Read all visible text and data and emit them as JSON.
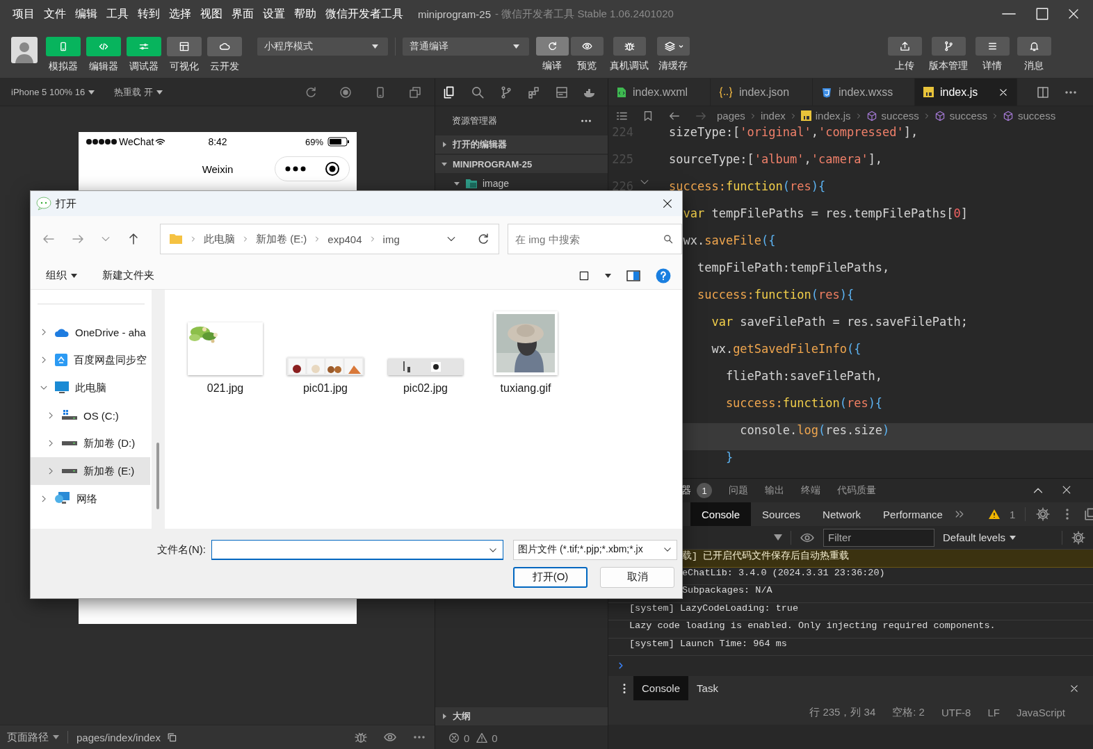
{
  "menu_bar": {
    "items": [
      "项目",
      "文件",
      "编辑",
      "工具",
      "转到",
      "选择",
      "视图",
      "界面",
      "设置",
      "帮助",
      "微信开发者工具"
    ],
    "title": "miniprogram-25",
    "subtitle": "- 微信开发者工具 Stable 1.06.2401020"
  },
  "toolbar": {
    "view_buttons": [
      {
        "label": "模拟器",
        "kind": "simulator",
        "on": true
      },
      {
        "label": "编辑器",
        "kind": "editor",
        "on": true
      },
      {
        "label": "调试器",
        "kind": "debugger",
        "on": true
      },
      {
        "label": "可视化",
        "kind": "visual",
        "on": false
      },
      {
        "label": "云开发",
        "kind": "cloud",
        "on": false
      }
    ],
    "mode": "小程序模式",
    "compile_mode": "普通编译",
    "actions": [
      {
        "label": "编译",
        "kind": "compile",
        "highlighted": true
      },
      {
        "label": "预览",
        "kind": "preview",
        "highlighted": false
      },
      {
        "label": "真机调试",
        "kind": "remote-debug",
        "highlighted": false
      },
      {
        "label": "清缓存",
        "kind": "clear-cache",
        "highlighted": false
      }
    ],
    "right_buttons": [
      {
        "label": "上传",
        "kind": "upload"
      },
      {
        "label": "版本管理",
        "kind": "version"
      },
      {
        "label": "详情",
        "kind": "details"
      },
      {
        "label": "消息",
        "kind": "messages"
      }
    ]
  },
  "simulator": {
    "device": "iPhone 5 100% 16",
    "hot_reload": "热重载 开",
    "network": "WeChat",
    "time": "8:42",
    "battery": "69%",
    "nav_title": "Weixin",
    "page_path_label": "页面路径",
    "page_path": "pages/index/index"
  },
  "explorer": {
    "title": "资源管理器",
    "sections": [
      {
        "label": "打开的编辑器",
        "expanded": false
      },
      {
        "label": "MINIPROGRAM-25",
        "expanded": true,
        "children": [
          {
            "label": "image",
            "kind": "folder",
            "expanded": true
          }
        ]
      }
    ],
    "outline": {
      "label": "大纲",
      "expanded": false
    },
    "errors": "0",
    "warnings": "0"
  },
  "editor": {
    "tabs": [
      {
        "name": "index.wxml",
        "kind": "wxml",
        "selected": false
      },
      {
        "name": "index.json",
        "kind": "json",
        "selected": false
      },
      {
        "name": "index.wxss",
        "kind": "wxss",
        "selected": false
      },
      {
        "name": "index.js",
        "kind": "js",
        "selected": true
      }
    ],
    "breadcrumb": [
      {
        "text": "pages",
        "kind": "folder"
      },
      {
        "text": "index",
        "kind": "folder"
      },
      {
        "text": "index.js",
        "kind": "js"
      },
      {
        "text": "success",
        "kind": "method"
      },
      {
        "text": "success",
        "kind": "method"
      },
      {
        "text": "success",
        "kind": "method"
      }
    ],
    "line_numbers": [
      "224",
      "225",
      "226"
    ],
    "lines": [
      {
        "highlighted": false,
        "tokens": [
          {
            "kind": "plain",
            "text": "sizeType:["
          },
          {
            "kind": "str",
            "text": "'original'"
          },
          {
            "kind": "plain",
            "text": ","
          },
          {
            "kind": "str",
            "text": "'compressed'"
          },
          {
            "kind": "plain",
            "text": "],"
          }
        ]
      },
      {
        "highlighted": false,
        "tokens": [
          {
            "kind": "plain",
            "text": "sourceType:["
          },
          {
            "kind": "str",
            "text": "'album'"
          },
          {
            "kind": "plain",
            "text": ","
          },
          {
            "kind": "str",
            "text": "'camera'"
          },
          {
            "kind": "plain",
            "text": "],"
          }
        ]
      },
      {
        "highlighted": false,
        "tokens": [
          {
            "kind": "prop",
            "text": "success:"
          },
          {
            "kind": "kw",
            "text": "function"
          },
          {
            "kind": "brace",
            "text": "("
          },
          {
            "kind": "param",
            "text": "res"
          },
          {
            "kind": "brace",
            "text": "){"
          }
        ]
      },
      {
        "highlighted": false,
        "tokens": [
          {
            "kind": "kw",
            "text": "  var"
          },
          {
            "kind": "plain",
            "text": " tempFilePaths = res.tempFilePaths["
          },
          {
            "kind": "num",
            "text": "0"
          },
          {
            "kind": "plain",
            "text": "]"
          }
        ]
      },
      {
        "highlighted": false,
        "tokens": [
          {
            "kind": "plain",
            "text": "  wx."
          },
          {
            "kind": "prop",
            "text": "saveFile"
          },
          {
            "kind": "brace",
            "text": "({"
          }
        ]
      },
      {
        "highlighted": false,
        "tokens": [
          {
            "kind": "plain",
            "text": "    tempFilePath:tempFilePaths,"
          }
        ]
      },
      {
        "highlighted": false,
        "tokens": [
          {
            "kind": "prop",
            "text": "    success:"
          },
          {
            "kind": "kw",
            "text": "function"
          },
          {
            "kind": "brace",
            "text": "("
          },
          {
            "kind": "param",
            "text": "res"
          },
          {
            "kind": "brace",
            "text": "){"
          }
        ]
      },
      {
        "highlighted": false,
        "tokens": [
          {
            "kind": "kw",
            "text": "      var"
          },
          {
            "kind": "plain",
            "text": " saveFilePath = res.saveFilePath;"
          }
        ]
      },
      {
        "highlighted": false,
        "tokens": [
          {
            "kind": "plain",
            "text": "      wx."
          },
          {
            "kind": "prop",
            "text": "getSavedFileInfo"
          },
          {
            "kind": "brace",
            "text": "({"
          }
        ]
      },
      {
        "highlighted": false,
        "tokens": [
          {
            "kind": "plain",
            "text": "        fliePath:saveFilePath,"
          }
        ]
      },
      {
        "highlighted": false,
        "tokens": [
          {
            "kind": "prop",
            "text": "        success:"
          },
          {
            "kind": "kw",
            "text": "function"
          },
          {
            "kind": "brace",
            "text": "("
          },
          {
            "kind": "param",
            "text": "res"
          },
          {
            "kind": "brace",
            "text": "){"
          }
        ]
      },
      {
        "highlighted": true,
        "tokens": [
          {
            "kind": "plain",
            "text": "          console."
          },
          {
            "kind": "prop",
            "text": "log"
          },
          {
            "kind": "brace",
            "text": "("
          },
          {
            "kind": "plain",
            "text": "res.size"
          },
          {
            "kind": "brace",
            "text": ")"
          }
        ]
      },
      {
        "highlighted": false,
        "tokens": [
          {
            "kind": "brace",
            "text": "        }"
          }
        ]
      }
    ]
  },
  "debug_panel": {
    "tabs": [
      {
        "label": "器",
        "badge": "1",
        "selected": true
      },
      {
        "label": "问题",
        "selected": false
      },
      {
        "label": "输出",
        "selected": false
      },
      {
        "label": "终端",
        "selected": false
      },
      {
        "label": "代码质量",
        "selected": false
      }
    ],
    "devtools_tabs": [
      {
        "label": "Console",
        "selected": true
      },
      {
        "label": "Sources",
        "selected": false
      },
      {
        "label": "Network",
        "selected": false
      },
      {
        "label": "Performance",
        "selected": false
      }
    ],
    "warning_count": "1",
    "filter_placeholder": "Filter",
    "levels": "Default levels",
    "messages": [
      {
        "text": "载] 已开启代码文件保存后自动热重载",
        "kind": "warning",
        "clipped": true
      },
      {
        "text": "eChatLib: 3.4.0 (2024.3.31 23:36:20)",
        "kind": "log",
        "clipped": true
      },
      {
        "text": "Subpackages: N/A",
        "kind": "log",
        "clipped": true
      },
      {
        "text": "[system] LazyCodeLoading: true",
        "kind": "log",
        "clipped": false
      },
      {
        "text": "Lazy code loading is enabled. Only injecting required components.",
        "kind": "log",
        "clipped": false
      },
      {
        "text": "[system] Launch Time: 964 ms",
        "kind": "log",
        "clipped": false
      }
    ],
    "drawer_tabs": [
      {
        "label": "Console",
        "selected": true
      },
      {
        "label": "Task",
        "selected": false
      }
    ]
  },
  "status_bar": {
    "position": "行 235，列 34",
    "spaces": "空格: 2",
    "encoding": "UTF-8",
    "eol": "LF",
    "language": "JavaScript"
  },
  "dialog": {
    "title": "打开",
    "path": [
      "此电脑",
      "新加卷 (E:)",
      "exp404",
      "img"
    ],
    "search_placeholder": "在 img 中搜索",
    "organize": "组织",
    "new_folder": "新建文件夹",
    "tree": [
      {
        "label": "OneDrive - aha",
        "kind": "cloud",
        "expanded": false,
        "selected": false
      },
      {
        "label": "百度网盘同步空",
        "kind": "sync",
        "expanded": false,
        "selected": false
      },
      {
        "label": "此电脑",
        "kind": "pc",
        "expanded": true,
        "selected": false,
        "children": [
          {
            "label": "OS (C:)",
            "kind": "os-drive",
            "expanded": false,
            "selected": false
          },
          {
            "label": "新加卷 (D:)",
            "kind": "drive",
            "expanded": false,
            "selected": false
          },
          {
            "label": "新加卷 (E:)",
            "kind": "drive",
            "expanded": false,
            "selected": true
          }
        ]
      },
      {
        "label": "网络",
        "kind": "network",
        "expanded": false,
        "selected": false
      }
    ],
    "files": [
      {
        "name": "021.jpg",
        "kind": "picture"
      },
      {
        "name": "pic01.jpg",
        "kind": "picture"
      },
      {
        "name": "pic02.jpg",
        "kind": "picture"
      },
      {
        "name": "tuxiang.gif",
        "kind": "picture"
      }
    ],
    "filename_label": "文件名(N):",
    "filetype": "图片文件 (*.tif;*.pjp;*.xbm;*.jx",
    "buttons": [
      {
        "label": "打开(O)",
        "primary": true
      },
      {
        "label": "取消",
        "primary": false
      }
    ]
  }
}
